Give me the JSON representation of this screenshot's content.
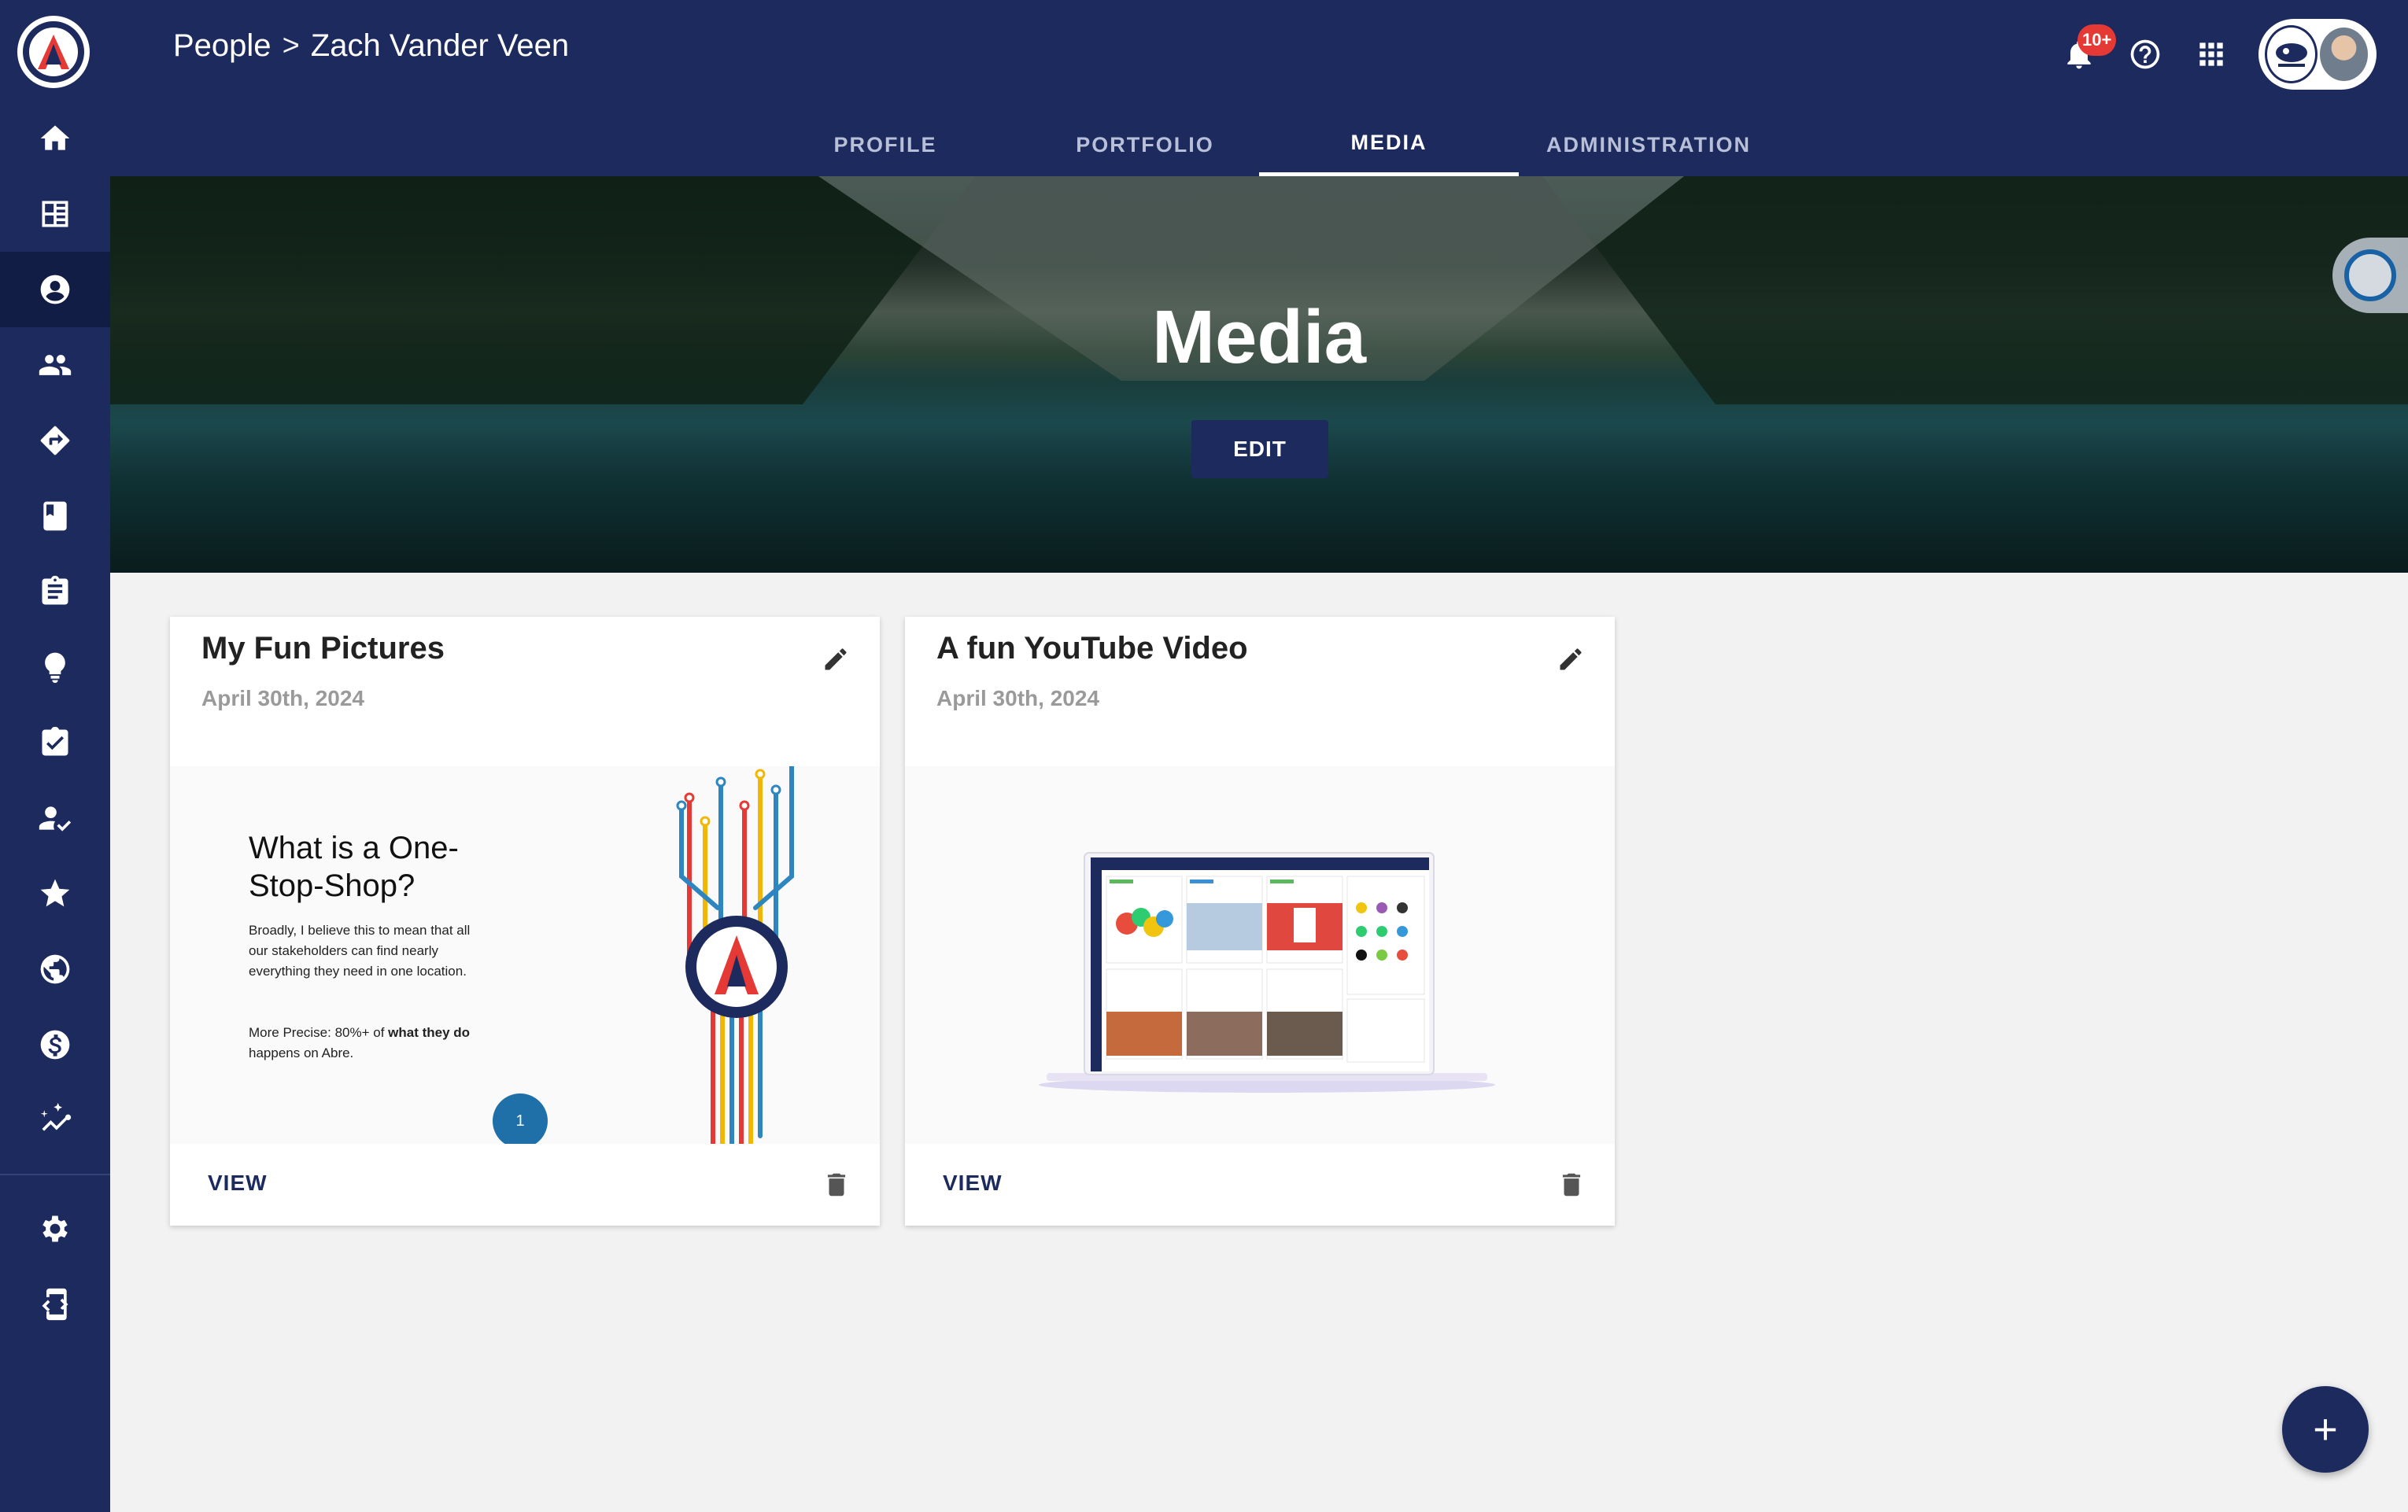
{
  "header": {
    "breadcrumb": [
      "People",
      "Zach Vander Veen"
    ],
    "breadcrumb_separator": ">",
    "notification_badge": "10+"
  },
  "tabs": [
    {
      "label": "PROFILE",
      "active": false
    },
    {
      "label": "PORTFOLIO",
      "active": false
    },
    {
      "label": "MEDIA",
      "active": true
    },
    {
      "label": "ADMINISTRATION",
      "active": false
    }
  ],
  "hero": {
    "title": "Media",
    "edit_label": "EDIT"
  },
  "sidebar": {
    "items": [
      {
        "icon": "home-icon"
      },
      {
        "icon": "dashboard-icon"
      },
      {
        "icon": "account-circle-icon",
        "active": true
      },
      {
        "icon": "people-icon"
      },
      {
        "icon": "directions-icon"
      },
      {
        "icon": "book-icon"
      },
      {
        "icon": "clipboard-icon"
      },
      {
        "icon": "lightbulb-icon"
      },
      {
        "icon": "checklist-icon"
      },
      {
        "icon": "person-check-icon"
      },
      {
        "icon": "star-icon"
      },
      {
        "icon": "globe-icon"
      },
      {
        "icon": "dollar-icon"
      },
      {
        "icon": "analytics-icon"
      },
      {
        "icon": "settings-icon"
      },
      {
        "icon": "code-icon"
      }
    ]
  },
  "cards": [
    {
      "title": "My Fun Pictures",
      "date": "April 30th, 2024",
      "view_label": "VIEW",
      "slide": {
        "heading": "What is a One-Stop-Shop?",
        "body": "Broadly, I believe this to mean that all our stakeholders can find nearly everything they need in one location.",
        "body2_prefix": "More Precise: 80%+ of ",
        "body2_bold1": "what they do",
        "body2_suffix": " happens on Abre.",
        "page": "1"
      }
    },
    {
      "title": "A fun YouTube Video",
      "date": "April 30th, 2024",
      "view_label": "VIEW"
    }
  ],
  "fab_label": "+",
  "colors": {
    "navy": "#1c2a5e",
    "navy_active": "#121d45",
    "badge_red": "#e53935",
    "slide_blue": "#1f70a8"
  }
}
